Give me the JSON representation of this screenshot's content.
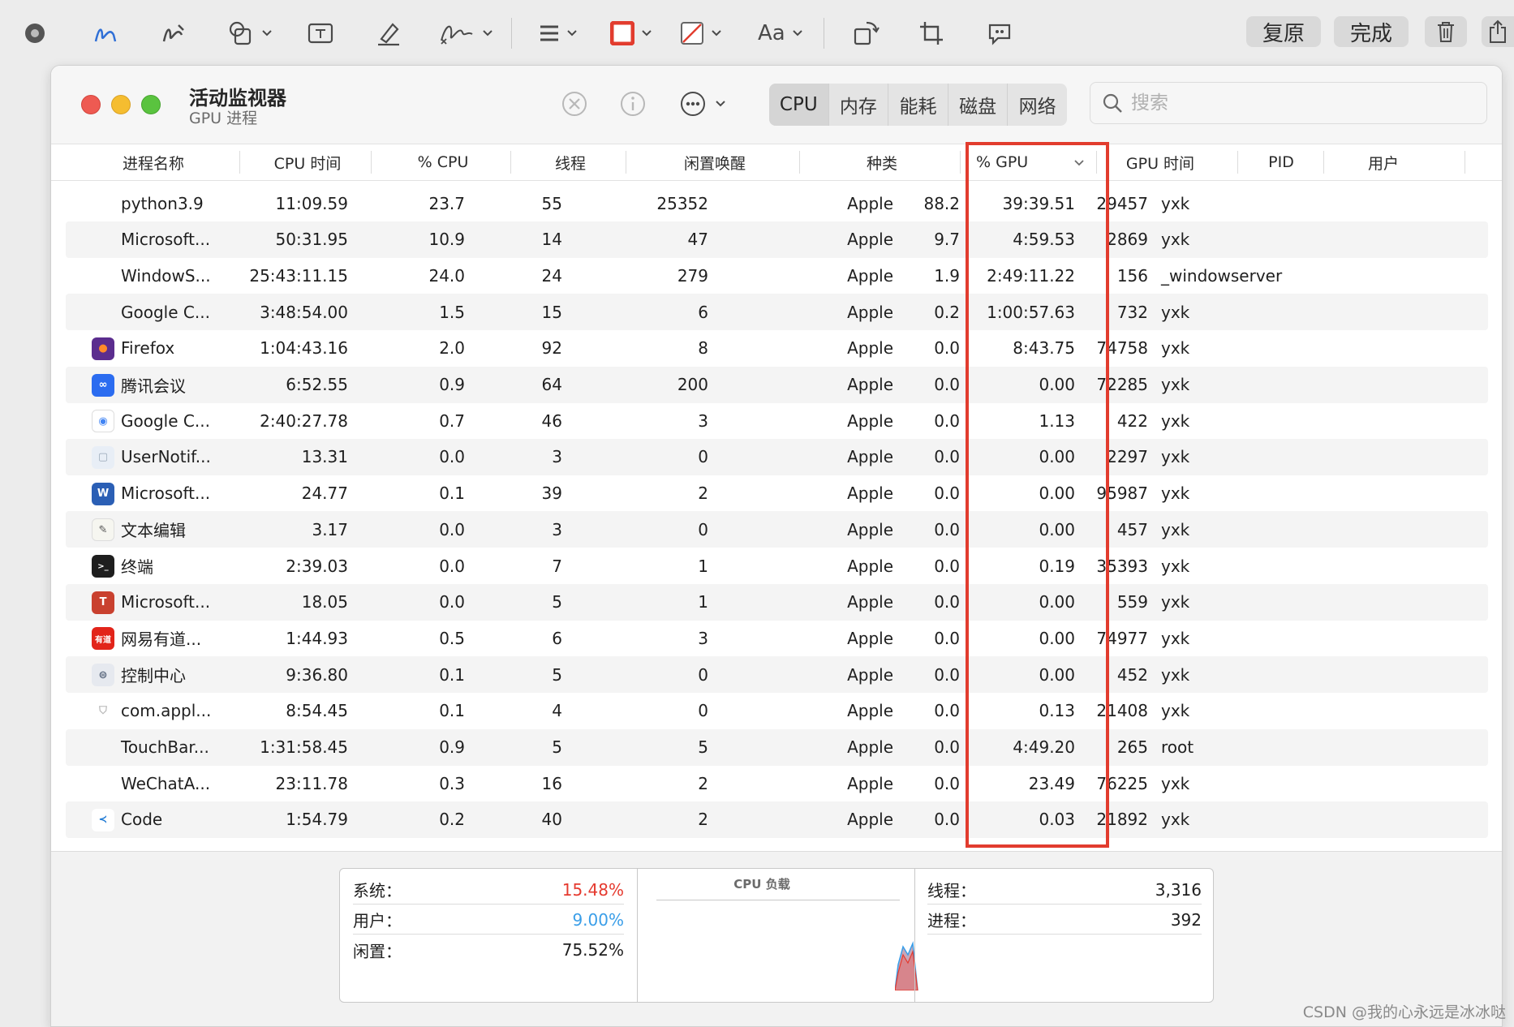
{
  "toolbar": {
    "restore_label": "复原",
    "done_label": "完成",
    "text_style_label": "Aa",
    "icons": [
      "sample-icon",
      "sketch-icon",
      "draw-icon",
      "shapes-icon",
      "text-box-icon",
      "highlight-icon",
      "sign-icon",
      "shape-style-icon",
      "border-color-icon",
      "fill-color-icon",
      "text-style-icon",
      "rotate-icon",
      "crop-icon",
      "annotate-icon",
      "trash-icon",
      "share-icon"
    ]
  },
  "window": {
    "title": "活动监视器",
    "subtitle": "GPU 进程",
    "tabs": [
      "CPU",
      "内存",
      "能耗",
      "磁盘",
      "网络"
    ],
    "active_tab": "CPU",
    "search_placeholder": "搜索"
  },
  "table": {
    "columns": [
      "进程名称",
      "CPU 时间",
      "% CPU",
      "线程",
      "闲置唤醒",
      "种类",
      "% GPU",
      "GPU 时间",
      "PID",
      "用户"
    ],
    "sorted_column": "% GPU",
    "rows": [
      {
        "name": "python3.9",
        "icon": "none",
        "cpu_time": "11:09.59",
        "cpu": "23.7",
        "threads": "55",
        "wakeups": "25352",
        "kind": "Apple",
        "gpu": "88.2",
        "gpu_time": "39:39.51",
        "pid": "29457",
        "user": "yxk"
      },
      {
        "name": "Microsoft...",
        "icon": "none",
        "cpu_time": "50:31.95",
        "cpu": "10.9",
        "threads": "14",
        "wakeups": "47",
        "kind": "Apple",
        "gpu": "9.7",
        "gpu_time": "4:59.53",
        "pid": "2869",
        "user": "yxk"
      },
      {
        "name": "WindowS...",
        "icon": "none",
        "cpu_time": "25:43:11.15",
        "cpu": "24.0",
        "threads": "24",
        "wakeups": "279",
        "kind": "Apple",
        "gpu": "1.9",
        "gpu_time": "2:49:11.22",
        "pid": "156",
        "user": "_windowserver"
      },
      {
        "name": "Google C...",
        "icon": "none",
        "cpu_time": "3:48:54.00",
        "cpu": "1.5",
        "threads": "15",
        "wakeups": "6",
        "kind": "Apple",
        "gpu": "0.2",
        "gpu_time": "1:00:57.63",
        "pid": "732",
        "user": "yxk"
      },
      {
        "name": "Firefox",
        "icon": "firefox-icon",
        "cpu_time": "1:04:43.16",
        "cpu": "2.0",
        "threads": "92",
        "wakeups": "8",
        "kind": "Apple",
        "gpu": "0.0",
        "gpu_time": "8:43.75",
        "pid": "74758",
        "user": "yxk"
      },
      {
        "name": "腾讯会议",
        "icon": "tencent-meeting-icon",
        "cpu_time": "6:52.55",
        "cpu": "0.9",
        "threads": "64",
        "wakeups": "200",
        "kind": "Apple",
        "gpu": "0.0",
        "gpu_time": "0.00",
        "pid": "72285",
        "user": "yxk"
      },
      {
        "name": "Google C...",
        "icon": "chrome-icon",
        "cpu_time": "2:40:27.78",
        "cpu": "0.7",
        "threads": "46",
        "wakeups": "3",
        "kind": "Apple",
        "gpu": "0.0",
        "gpu_time": "1.13",
        "pid": "422",
        "user": "yxk"
      },
      {
        "name": "UserNotif...",
        "icon": "user-notification-icon",
        "cpu_time": "13.31",
        "cpu": "0.0",
        "threads": "3",
        "wakeups": "0",
        "kind": "Apple",
        "gpu": "0.0",
        "gpu_time": "0.00",
        "pid": "2297",
        "user": "yxk"
      },
      {
        "name": "Microsoft...",
        "icon": "word-icon",
        "cpu_time": "24.77",
        "cpu": "0.1",
        "threads": "39",
        "wakeups": "2",
        "kind": "Apple",
        "gpu": "0.0",
        "gpu_time": "0.00",
        "pid": "95987",
        "user": "yxk"
      },
      {
        "name": "文本编辑",
        "icon": "textedit-icon",
        "cpu_time": "3.17",
        "cpu": "0.0",
        "threads": "3",
        "wakeups": "0",
        "kind": "Apple",
        "gpu": "0.0",
        "gpu_time": "0.00",
        "pid": "457",
        "user": "yxk"
      },
      {
        "name": "终端",
        "icon": "terminal-icon",
        "cpu_time": "2:39.03",
        "cpu": "0.0",
        "threads": "7",
        "wakeups": "1",
        "kind": "Apple",
        "gpu": "0.0",
        "gpu_time": "0.19",
        "pid": "35393",
        "user": "yxk"
      },
      {
        "name": "Microsoft...",
        "icon": "teams-icon",
        "cpu_time": "18.05",
        "cpu": "0.0",
        "threads": "5",
        "wakeups": "1",
        "kind": "Apple",
        "gpu": "0.0",
        "gpu_time": "0.00",
        "pid": "559",
        "user": "yxk"
      },
      {
        "name": "网易有道...",
        "icon": "youdao-icon",
        "cpu_time": "1:44.93",
        "cpu": "0.5",
        "threads": "6",
        "wakeups": "3",
        "kind": "Apple",
        "gpu": "0.0",
        "gpu_time": "0.00",
        "pid": "74977",
        "user": "yxk"
      },
      {
        "name": "控制中心",
        "icon": "control-center-icon",
        "cpu_time": "9:36.80",
        "cpu": "0.1",
        "threads": "5",
        "wakeups": "0",
        "kind": "Apple",
        "gpu": "0.0",
        "gpu_time": "0.00",
        "pid": "452",
        "user": "yxk"
      },
      {
        "name": "com.appl...",
        "icon": "shield-icon",
        "cpu_time": "8:54.45",
        "cpu": "0.1",
        "threads": "4",
        "wakeups": "0",
        "kind": "Apple",
        "gpu": "0.0",
        "gpu_time": "0.13",
        "pid": "21408",
        "user": "yxk"
      },
      {
        "name": "TouchBar...",
        "icon": "none",
        "cpu_time": "1:31:58.45",
        "cpu": "0.9",
        "threads": "5",
        "wakeups": "5",
        "kind": "Apple",
        "gpu": "0.0",
        "gpu_time": "4:49.20",
        "pid": "265",
        "user": "root"
      },
      {
        "name": "WeChatA...",
        "icon": "none",
        "cpu_time": "23:11.78",
        "cpu": "0.3",
        "threads": "16",
        "wakeups": "2",
        "kind": "Apple",
        "gpu": "0.0",
        "gpu_time": "23.49",
        "pid": "76225",
        "user": "yxk"
      },
      {
        "name": "Code",
        "icon": "vscode-icon",
        "cpu_time": "1:54.79",
        "cpu": "0.2",
        "threads": "40",
        "wakeups": "2",
        "kind": "Apple",
        "gpu": "0.0",
        "gpu_time": "0.03",
        "pid": "21892",
        "user": "yxk"
      }
    ]
  },
  "stats": {
    "system_label": "系统：",
    "system_value": "15.48%",
    "user_label": "用户：",
    "user_value": "9.00%",
    "idle_label": "闲置：",
    "idle_value": "75.52%",
    "cpu_load_title": "CPU 负载",
    "threads_label": "线程：",
    "threads_value": "3,316",
    "processes_label": "进程：",
    "processes_value": "392"
  },
  "colors": {
    "highlight": "#e23c2e",
    "system": "#e53a2f",
    "user": "#3a9ee8"
  },
  "watermark": "CSDN @我的心永远是冰冰哒"
}
